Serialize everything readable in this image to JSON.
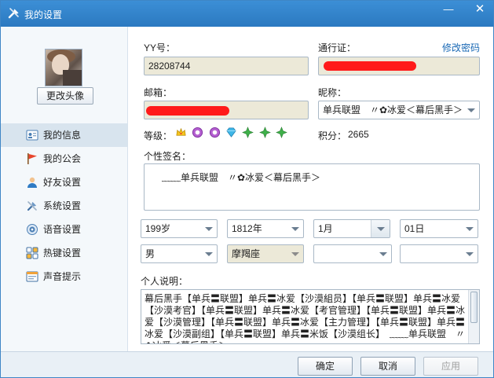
{
  "window": {
    "title": "我的设置",
    "minimize_glyph": "—",
    "close_glyph": "✕"
  },
  "sidebar": {
    "change_avatar": "更改头像",
    "items": [
      {
        "label": "我的信息",
        "icon": "id-card-icon",
        "active": true
      },
      {
        "label": "我的公会",
        "icon": "flag-icon",
        "active": false
      },
      {
        "label": "好友设置",
        "icon": "friend-icon",
        "active": false
      },
      {
        "label": "系统设置",
        "icon": "tools-icon",
        "active": false
      },
      {
        "label": "语音设置",
        "icon": "voice-icon",
        "active": false
      },
      {
        "label": "热键设置",
        "icon": "hotkey-icon",
        "active": false
      },
      {
        "label": "声音提示",
        "icon": "sound-tip-icon",
        "active": false
      }
    ]
  },
  "form": {
    "yy_label": "YY号：",
    "yy_value": "28208744",
    "passport_label": "通行证：",
    "change_password": "修改密码",
    "email_label": "邮箱：",
    "nickname_label": "昵称：",
    "nickname_value": "单兵联盟　〃✿冰爱＜幕后黑手＞",
    "level_label": "等级：",
    "points_label": "积分：",
    "points_value": "2665",
    "signature_label": "个性签名：",
    "signature_value": "﹏﹏单兵联盟　〃✿冰爱＜幕后黑手＞",
    "age": "199岁",
    "birth_year": "1812年",
    "birth_month": "1月",
    "birth_day": "01日",
    "gender": "男",
    "constellation": "摩羯座",
    "province": "",
    "city": "",
    "description_label": "个人说明：",
    "description_value": "幕后黑手【单兵〓联盟】单兵〓冰爱【沙漠組员】【单兵〓联盟】单兵〓冰爱【沙漠考官】【单兵〓联盟】单兵〓冰爱【考官管理】【单兵〓联盟】单兵〓冰爱【沙漠管理】【单兵〓联盟】单兵〓冰爱【主力管理】【单兵〓联盟】单兵〓冰爱【沙漠副组】【单兵〓联盟】单兵〓米饭【沙漠组长】　﹏﹏单兵联盟　〃✿冰爱＜幕后黑手＞"
  },
  "colors": {
    "titlebar": "#2b79c0",
    "redaction": "#ff1a1a",
    "link": "#1a69b5"
  },
  "footer": {
    "ok": "确定",
    "cancel": "取消",
    "apply": "应用"
  }
}
